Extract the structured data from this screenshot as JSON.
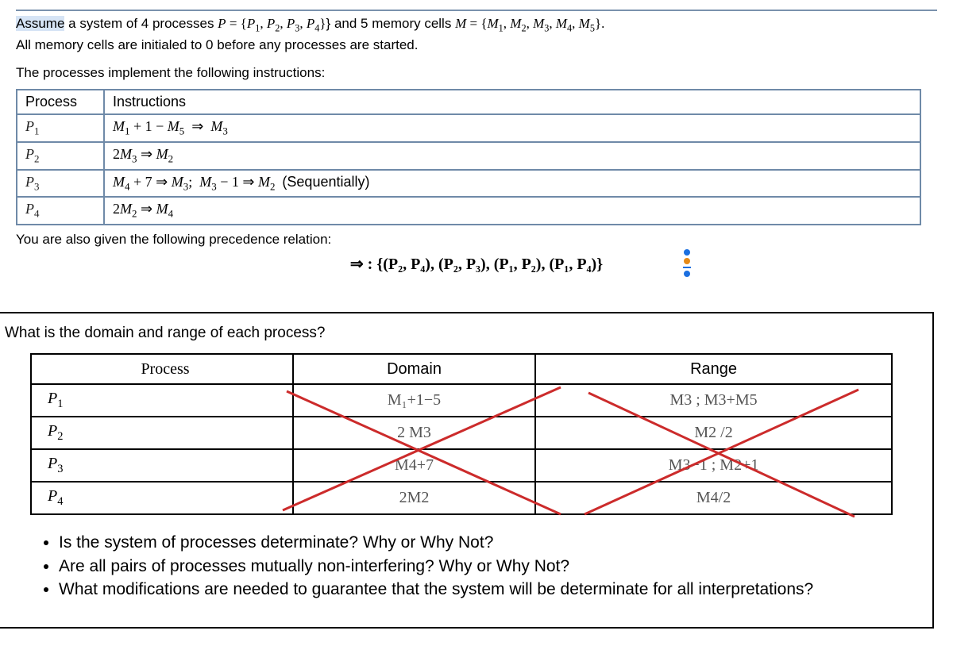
{
  "intro": {
    "assume": "Assume",
    "line1_part1": " a system of 4 processes ",
    "line1_P_eq": "P = {P",
    "line1_Plist": ", P",
    "line1_after_set": "} and 5 memory cells ",
    "line1_M_eq": "M = {M",
    "line1_Mlist": ", M",
    "line1_end": "}.",
    "line2": "All memory cells are initialed to 0 before any processes are started.",
    "line3": "The processes implement the following instructions:"
  },
  "table1": {
    "h1": "Process",
    "h2": "Instructions",
    "rows": [
      {
        "proc": "P",
        "psub": "1",
        "instr": "M₁ + 1 − M₅  ⇒  M₃"
      },
      {
        "proc": "P",
        "psub": "2",
        "instr": "2M₃ ⇒ M₂"
      },
      {
        "proc": "P",
        "psub": "3",
        "instr": "M₄ + 7 ⇒ M₃;  M₃ − 1 ⇒ M₂  (Sequentially)"
      },
      {
        "proc": "P",
        "psub": "4",
        "instr": "2M₂ ⇒ M₄"
      }
    ]
  },
  "precedence": {
    "label": "You are also given the following precedence relation:",
    "expr": "⇒ :  {(P₂, P₄), (P₂, P₃), (P₁, P₂), (P₁, P₄)}"
  },
  "question2": "What is the domain and range of each process?",
  "table2": {
    "h1": "Process",
    "h2": "Domain",
    "h3": "Range",
    "rows": [
      {
        "proc": "P₁",
        "domain": "M₁+1−5",
        "range": "M3 ; M3+M5"
      },
      {
        "proc": "P₂",
        "domain": "2 M3",
        "range": "M2 /2"
      },
      {
        "proc": "P₃",
        "domain": "M4+7",
        "range": "M3−1 ; M2+1"
      },
      {
        "proc": "P₄",
        "domain": "2M2",
        "range": "M4/2"
      }
    ]
  },
  "bullets": [
    "Is the system of processes determinate? Why or Why Not?",
    "Are all pairs of processes mutually non-interfering? Why or Why Not?",
    "What modifications are needed to guarantee that the system will be determinate for all interpretations?"
  ]
}
